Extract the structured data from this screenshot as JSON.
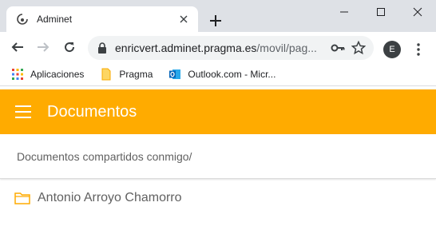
{
  "browser": {
    "tab_title": "Adminet",
    "url_host": "enricvert.adminet.pragma.es",
    "url_path": "/movil/pag...",
    "profile_initial": "E",
    "bookmarks": [
      {
        "label": "Aplicaciones",
        "icon": "apps-grid-icon"
      },
      {
        "label": "Pragma",
        "icon": "folder-icon"
      },
      {
        "label": "Outlook.com - Micr...",
        "icon": "outlook-icon"
      }
    ]
  },
  "app": {
    "title": "Documentos",
    "accent_color": "#ffab00",
    "breadcrumb": "Documentos compartidos conmigo/",
    "items": [
      {
        "name": "Antonio Arroyo Chamorro",
        "icon": "folder-outline-icon"
      }
    ]
  }
}
